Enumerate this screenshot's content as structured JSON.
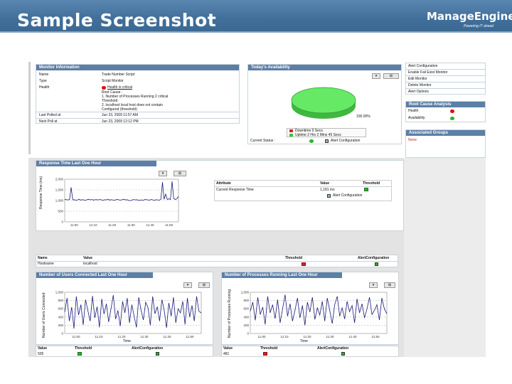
{
  "slide_title": "Sample Screenshot",
  "logo": {
    "name": "ManageEngine",
    "tagline": "Powering IT ahead"
  },
  "colors": {
    "banner": "#3b6a93",
    "panel_header": "#5b7fa6",
    "gray_panel": "#e3e3e3",
    "pie": "#5fe35f",
    "line": "#1a1a7a"
  },
  "monitor_info": {
    "header": "Monitor Information",
    "rows": [
      {
        "label": "Name",
        "value": "Trade Number Script"
      },
      {
        "label": "Type",
        "value": "Script Monitor"
      },
      {
        "label": "Health",
        "value": "Health is critical"
      }
    ],
    "root_cause": [
      "Root Cause :",
      "1. Number of Processes Running 2 critical",
      "Threshold",
      "2. localhost local host does not contain",
      "Configured (threshold)"
    ],
    "polled": [
      {
        "label": "Last Polled at",
        "value": "Jun 23, 2009 11:57 AM"
      },
      {
        "label": "Next Poll at",
        "value": "Jun 23, 2009 12:12 PM"
      }
    ]
  },
  "availability": {
    "header": "Today's Availability",
    "pct_label": "100.00%",
    "legend": [
      "Downtime 0 Secs",
      "Uptime 2 Hrs 2 Mins 45 Secs"
    ],
    "current_status_label": "Current Status :",
    "alert_config_label": "Alert Configuration",
    "up_fraction": 1.0
  },
  "right_links": {
    "links": [
      "Alert Configuration",
      "Enable Fail Exist Monitor",
      "Edit Monitor",
      "Delete Monitor",
      "Alert Options"
    ],
    "rca_header": "Root Cause Analysis",
    "rca_items": [
      "Health",
      "Availability"
    ],
    "groups_header": "Associated Groups",
    "groups_value": "None"
  },
  "response_time": {
    "header": "Response Time  Last One Hour",
    "ylabel": "Response Time (ms)",
    "xlabel": "ms",
    "table": {
      "headers": [
        "Attribute",
        "Value",
        "Threshold"
      ],
      "row": [
        "Current Response Time",
        "1,181 ms",
        ""
      ],
      "link": "Alert Configuration"
    }
  },
  "name_table": {
    "headers": [
      "Name",
      "Value",
      "Threshold",
      "AlertConfiguration"
    ],
    "row": [
      "Hostname",
      "localhost"
    ]
  },
  "users_panel": {
    "header": "Number of Users Connected  Last One Hour",
    "ylabel": "Number of Users Connected",
    "xlabel": "Time",
    "table_headers": [
      "Value",
      "Threshold",
      "AlertConfiguration"
    ],
    "table_value": "505"
  },
  "processes_panel": {
    "header": "Number of Processes Running  Last One Hour",
    "ylabel": "Number of Processes Running",
    "xlabel": "Time",
    "table_headers": [
      "Value",
      "Threshold",
      "AlertConfiguration"
    ],
    "table_value": "481"
  },
  "chart_data": [
    {
      "type": "line",
      "title": "Response Time  Last One Hour",
      "x": [
        "11:00",
        "11:10",
        "11:20",
        "11:30",
        "11:40",
        "11:50"
      ],
      "ylim": [
        0,
        2000
      ],
      "y_ticks": [
        0,
        500,
        1000,
        1500,
        2000
      ],
      "series": [
        {
          "values": [
            1060,
            1040,
            1030,
            1050,
            1620,
            1030,
            1040,
            1010,
            1030,
            1060,
            1020,
            1040,
            1030,
            1010,
            1040,
            1060,
            1030,
            1050,
            1020,
            1040,
            1040,
            1030,
            1050,
            1030,
            1010,
            1040,
            1030,
            1060,
            1020,
            1040,
            1030,
            1010,
            1040,
            1050,
            1030,
            1020,
            1040,
            1060,
            1030,
            1040,
            1000,
            1000,
            1020,
            1050,
            1030,
            1040,
            1010,
            1020,
            1030,
            1010,
            1050,
            1040,
            1030,
            1020,
            1050,
            1030,
            1010,
            1040,
            1030,
            1020,
            1050,
            1860,
            1060,
            1300,
            1050,
            1080,
            1050,
            1900,
            1100,
            1050,
            1080,
            1200
          ]
        }
      ]
    },
    {
      "type": "line",
      "title": "Number of Users Connected  Last One Hour",
      "x": [
        "11:00",
        "11:10",
        "11:20",
        "11:30",
        "11:40",
        "11:50"
      ],
      "ylim": [
        0,
        1000
      ],
      "y_ticks": [
        0,
        200,
        400,
        600,
        800,
        1000
      ],
      "series": [
        {
          "values": [
            520,
            860,
            300,
            640,
            120,
            900,
            450,
            700,
            210,
            820,
            560,
            300,
            910,
            380,
            650,
            150,
            840,
            470,
            720,
            280,
            600,
            930,
            350,
            560,
            180,
            780,
            500,
            860,
            260,
            700,
            420,
            150,
            880,
            560,
            330,
            760,
            620,
            200,
            900,
            480,
            650,
            300,
            820,
            560,
            140,
            740,
            420,
            880,
            260,
            600,
            500,
            780,
            220,
            860,
            400,
            680,
            300,
            900,
            540,
            500
          ]
        }
      ]
    },
    {
      "type": "line",
      "title": "Number of Processes Running  Last One Hour",
      "x": [
        "11:00",
        "11:10",
        "11:20",
        "11:30",
        "11:40",
        "11:50"
      ],
      "ylim": [
        0,
        1000
      ],
      "y_ticks": [
        0,
        200,
        400,
        600,
        800,
        1000
      ],
      "series": [
        {
          "values": [
            540,
            760,
            320,
            880,
            460,
            640,
            220,
            900,
            500,
            700,
            360,
            820,
            260,
            600,
            940,
            420,
            720,
            300,
            560,
            860,
            380,
            680,
            200,
            760,
            520,
            880,
            340,
            620,
            450,
            780,
            300,
            860,
            560,
            240,
            700,
            900,
            420,
            620,
            350,
            780,
            530,
            680,
            260,
            840,
            500,
            720,
            380,
            600,
            880,
            460,
            560,
            700,
            330,
            860,
            600,
            480
          ]
        }
      ]
    }
  ]
}
